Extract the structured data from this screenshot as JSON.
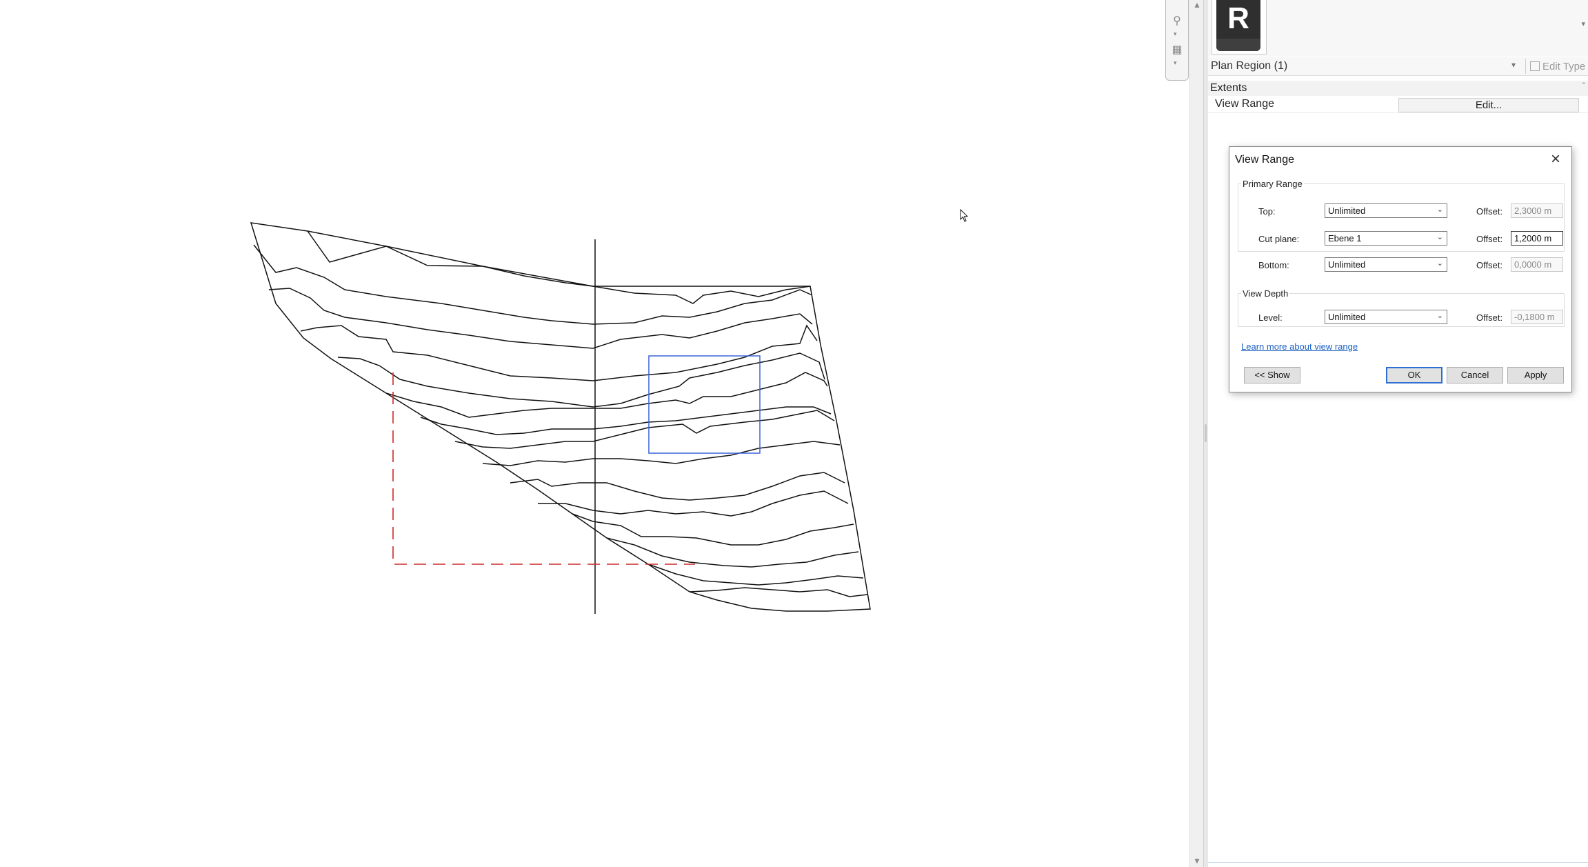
{
  "canvas": {
    "nav_icons": [
      "zoom-icon",
      "pan-icon"
    ]
  },
  "properties": {
    "type_icon_letter": "R",
    "selection_label": "Plan Region (1)",
    "edit_type_label": "Edit Type",
    "group_label": "Extents",
    "rows": [
      {
        "name": "View Range",
        "button": "Edit..."
      }
    ]
  },
  "dialog": {
    "title": "View Range",
    "primary_range": {
      "legend": "Primary Range",
      "top": {
        "label": "Top:",
        "value": "Unlimited",
        "offset_label": "Offset:",
        "offset": "2,3000 m",
        "offset_enabled": false
      },
      "cut_plane": {
        "label": "Cut plane:",
        "value": "Ebene 1",
        "offset_label": "Offset:",
        "offset": "1,2000 m",
        "offset_enabled": true
      },
      "bottom": {
        "label": "Bottom:",
        "value": "Unlimited",
        "offset_label": "Offset:",
        "offset": "0,0000 m",
        "offset_enabled": false
      }
    },
    "view_depth": {
      "legend": "View Depth",
      "level": {
        "label": "Level:",
        "value": "Unlimited",
        "offset_label": "Offset:",
        "offset": "-0,1800 m",
        "offset_enabled": false
      }
    },
    "link": "Learn more about view range",
    "buttons": {
      "show": "<< Show",
      "ok": "OK",
      "cancel": "Cancel",
      "apply": "Apply"
    }
  },
  "colors": {
    "selection_box": "#3b64d8",
    "section_line": "#cc2a2a",
    "link": "#1a5fc2"
  }
}
